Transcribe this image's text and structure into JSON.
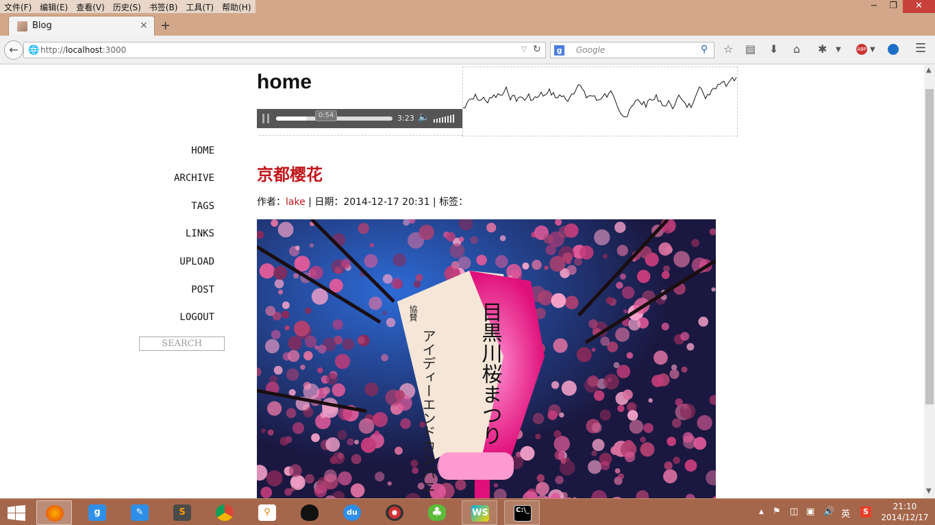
{
  "menu": [
    "文件(F)",
    "编辑(E)",
    "查看(V)",
    "历史(S)",
    "书签(B)",
    "工具(T)",
    "帮助(H)"
  ],
  "window_controls": {
    "minimize": "−",
    "restore": "❐",
    "close": "✕"
  },
  "tab": {
    "title": "Blog",
    "close": "×",
    "new_tab": "+"
  },
  "address": {
    "prefix": "http://",
    "host": "localhost",
    "port": ":3000"
  },
  "search": {
    "placeholder": "Google",
    "engine": "g"
  },
  "page": {
    "heading": "home",
    "audio": {
      "current_time": "0:54",
      "total_time": "3:23",
      "progress": 0.266
    },
    "nav": [
      "HOME",
      "ARCHIVE",
      "TAGS",
      "LINKS",
      "UPLOAD",
      "POST",
      "LOGOUT"
    ],
    "search_label": "SEARCH",
    "post": {
      "title": "京都樱花",
      "meta_author_label": "作者：",
      "meta_author": "lake",
      "meta_date_label": " | 日期：2014-12-17 20:31 | 标签："
    },
    "photo_text": {
      "lantern_main": "目黒川桜まつり",
      "lantern_side": "アイディーエンドカンパニー",
      "lantern_top": "協賛"
    }
  },
  "taskbar": {
    "time": "21:10",
    "date": "2014/12/17",
    "ime": "英",
    "apps": [
      "firefox",
      "baidu-guard",
      "notes",
      "sublime",
      "chrome",
      "search-tool",
      "qq",
      "baidu-netdisk",
      "media-player",
      "clover",
      "webstorm",
      "cmd"
    ]
  },
  "colors": {
    "titlebar": "#d3a88a",
    "accent": "#c0151b",
    "taskbar": "#a5674b"
  }
}
